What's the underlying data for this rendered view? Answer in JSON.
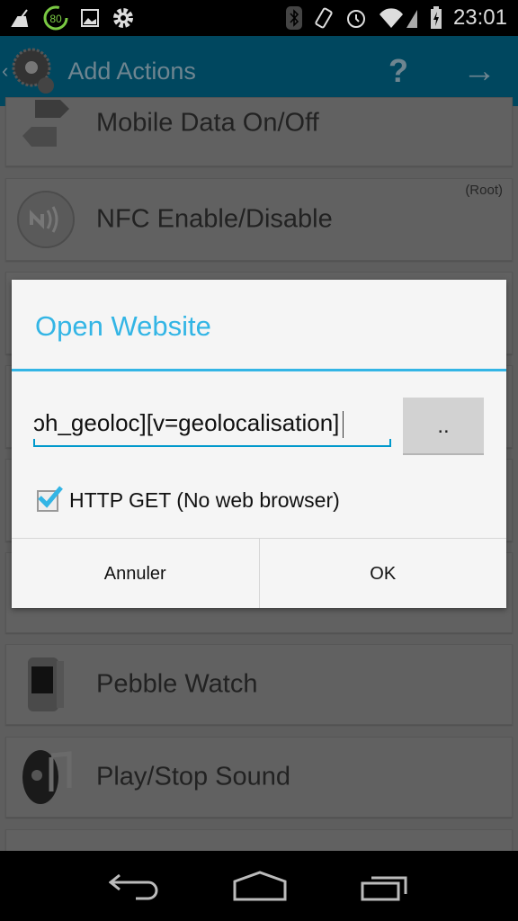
{
  "status_bar": {
    "time": "23:01",
    "battery_badge": "80",
    "left_icons": [
      "cleaner-icon",
      "battery-80-icon",
      "image-icon",
      "gear-icon"
    ],
    "right_icons": [
      "bluetooth-icon",
      "rotate-icon",
      "alarm-icon",
      "wifi-icon",
      "signal-icon",
      "battery-charging-icon"
    ]
  },
  "app_bar": {
    "title": "Add Actions",
    "help_label": "?",
    "next_icon": "arrow-right-icon",
    "back_icon": "chevron-left-icon"
  },
  "list": {
    "items": [
      {
        "label": "Mobile Data On/Off",
        "icon": "arrows-exchange-icon"
      },
      {
        "label": "NFC Enable/Disable",
        "badge": "(Root)",
        "icon": "nfc-icon"
      },
      {
        "label": "Pebble Watch",
        "icon": "watch-icon"
      },
      {
        "label": "Play/Stop Sound",
        "icon": "speaker-icon"
      }
    ]
  },
  "dialog": {
    "title": "Open Website",
    "url_value": "ɔh_geoloc][v=geolocalisation]",
    "browse_label": "..",
    "checkbox_label": "HTTP GET (No web browser)",
    "checkbox_checked": true,
    "cancel_label": "Annuler",
    "ok_label": "OK",
    "accent_color": "#33b5e5"
  },
  "nav_bar": {
    "icons": [
      "back-icon",
      "home-icon",
      "recents-icon"
    ]
  }
}
